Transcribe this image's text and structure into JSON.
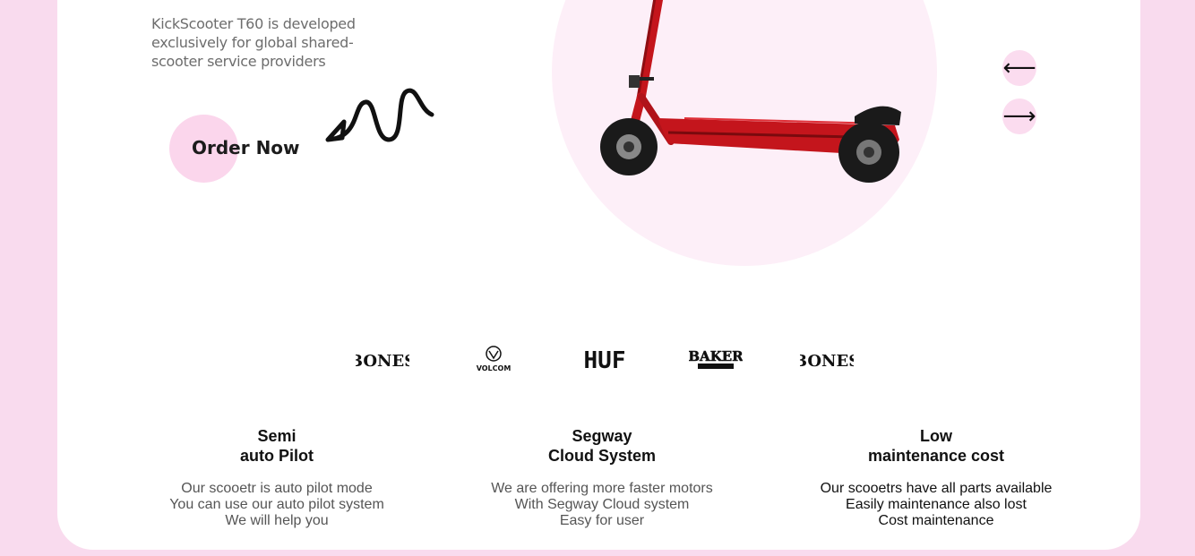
{
  "hero": {
    "description": "KickScooter T60 is developed exclusively for global shared-scooter service providers",
    "order_label": "Order Now",
    "product_image": "red-electric-scooter"
  },
  "carousel": {
    "prev_symbol": "⟵",
    "next_symbol": "⟶"
  },
  "brands": [
    {
      "name": "BONES",
      "icon": "bones-logo"
    },
    {
      "name": "VOLCOM",
      "icon": "volcom-logo"
    },
    {
      "name": "HUF",
      "icon": "huf-logo"
    },
    {
      "name": "BAKER",
      "icon": "baker-logo"
    },
    {
      "name": "BONES",
      "icon": "bones-logo"
    }
  ],
  "features": [
    {
      "title_line1": "Semi",
      "title_line2": "auto Pilot",
      "lines": [
        "Our scooetr is auto pilot mode",
        "You can use our auto pilot system",
        "We will help you"
      ]
    },
    {
      "title_line1": "Segway",
      "title_line2": "Cloud System",
      "lines": [
        "We are offering more faster motors",
        "With Segway Cloud system",
        "Easy for user"
      ]
    },
    {
      "title_line1": "Low",
      "title_line2": "maintenance cost",
      "lines": [
        "Our scooetrs have all parts available",
        "Easily maintenance also lost",
        "Cost maintenance"
      ]
    }
  ],
  "colors": {
    "page_bg": "#f9dbee",
    "accent_pink": "#fbd6ec",
    "scooter_red": "#c4151c"
  }
}
